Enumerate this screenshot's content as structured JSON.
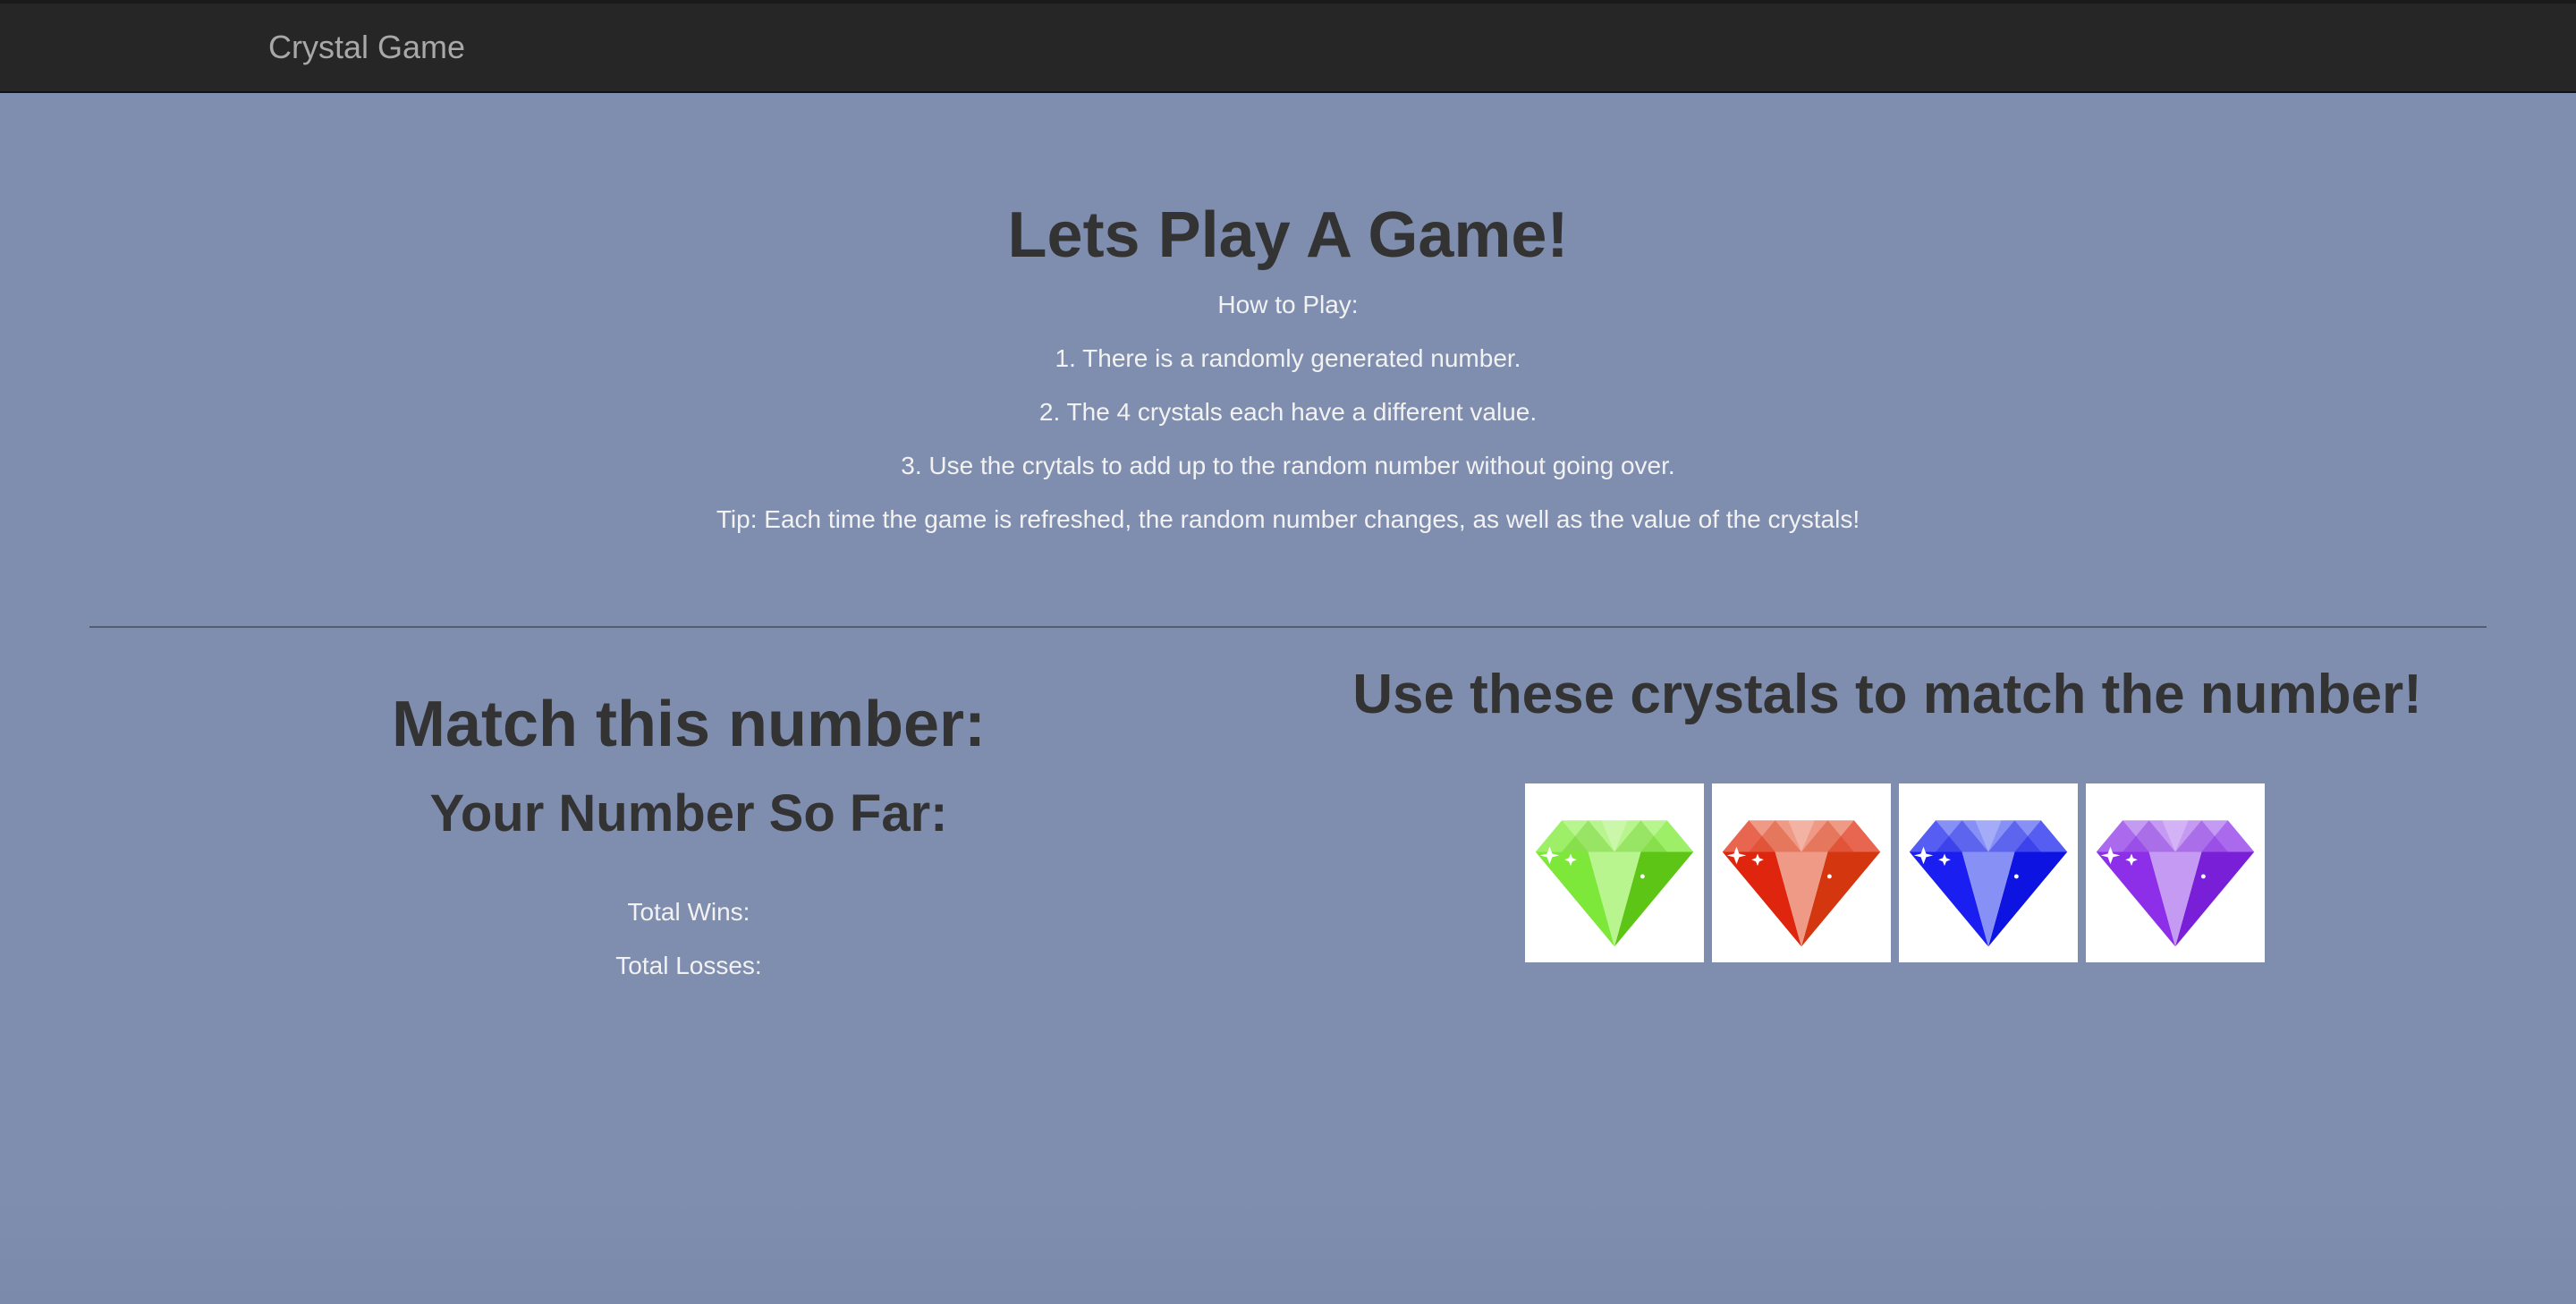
{
  "nav": {
    "brand": "Crystal Game"
  },
  "intro": {
    "title": "Lets Play A Game!",
    "how_to": "How to Play:",
    "step1": "1. There is a randomly generated number.",
    "step2": "2. The 4 crystals each have a different value.",
    "step3": "3. Use the crytals to add up to the random number without going over.",
    "tip": "Tip: Each time the game is refreshed, the random number changes, as well as the value of the crystals!"
  },
  "game": {
    "match_label": "Match this number:",
    "so_far_label": "Your Number So Far:",
    "wins_label": "Total Wins:",
    "losses_label": "Total Losses:",
    "crystals_heading": "Use these crystals to match the number!"
  },
  "crystals": [
    {
      "icon": "green-crystal-icon",
      "color": "#7ee83a",
      "light": "#b9f58e",
      "dark": "#5cc516"
    },
    {
      "icon": "red-crystal-icon",
      "color": "#e0250f",
      "light": "#ee9a86",
      "dark": "#d4360f"
    },
    {
      "icon": "blue-crystal-icon",
      "color": "#1a1ef0",
      "light": "#8790f5",
      "dark": "#0d13e0"
    },
    {
      "icon": "purple-crystal-icon",
      "color": "#8d2ee8",
      "light": "#c49af2",
      "dark": "#7a1fd8"
    }
  ]
}
